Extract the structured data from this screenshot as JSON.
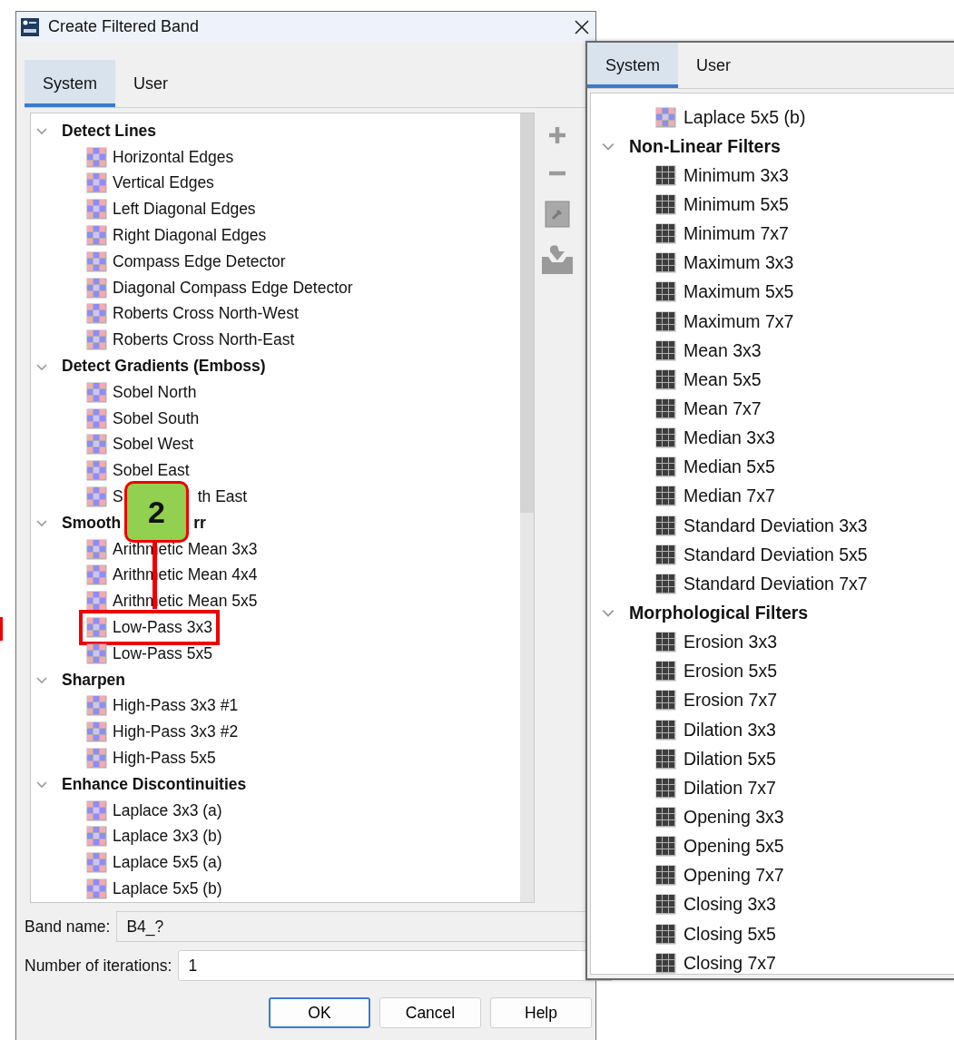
{
  "window": {
    "title": "Create Filtered Band"
  },
  "tabs": [
    {
      "label": "System",
      "selected": true
    },
    {
      "label": "User",
      "selected": false
    }
  ],
  "filter_tree": [
    {
      "label": "Detect Lines",
      "expanded": true,
      "children": [
        {
          "label": "Horizontal Edges",
          "kind": "linear",
          "highlighted": false
        },
        {
          "label": "Vertical Edges",
          "kind": "linear",
          "highlighted": false
        },
        {
          "label": "Left Diagonal Edges",
          "kind": "linear",
          "highlighted": false
        },
        {
          "label": "Right Diagonal Edges",
          "kind": "linear",
          "highlighted": false
        },
        {
          "label": "Compass Edge Detector",
          "kind": "linear",
          "highlighted": false
        },
        {
          "label": "Diagonal Compass Edge Detector",
          "kind": "linear",
          "highlighted": false
        },
        {
          "label": "Roberts Cross North-West",
          "kind": "linear",
          "highlighted": false
        },
        {
          "label": "Roberts Cross North-East",
          "kind": "linear",
          "highlighted": false
        }
      ]
    },
    {
      "label": "Detect Gradients (Emboss)",
      "expanded": true,
      "children": [
        {
          "label": "Sobel North",
          "kind": "linear",
          "highlighted": false
        },
        {
          "label": "Sobel South",
          "kind": "linear",
          "highlighted": false
        },
        {
          "label": "Sobel West",
          "kind": "linear",
          "highlighted": false
        },
        {
          "label": "Sobel East",
          "kind": "linear",
          "highlighted": false
        },
        {
          "fragments": [
            "S",
            "th East"
          ],
          "kind": "linear",
          "highlighted": false
        }
      ]
    },
    {
      "fragments": [
        "Smooth",
        "rr"
      ],
      "expanded": true,
      "children": [
        {
          "label": "Arithmetic Mean 3x3",
          "kind": "linear",
          "highlighted": false
        },
        {
          "label": "Arithmetic Mean 4x4",
          "kind": "linear",
          "highlighted": false
        },
        {
          "label": "Arithmetic Mean 5x5",
          "kind": "linear",
          "highlighted": false
        },
        {
          "label": "Low-Pass 3x3",
          "kind": "linear",
          "highlighted": true
        },
        {
          "label": "Low-Pass 5x5",
          "kind": "linear",
          "highlighted": false
        }
      ]
    },
    {
      "label": "Sharpen",
      "expanded": true,
      "children": [
        {
          "label": "High-Pass 3x3 #1",
          "kind": "linear",
          "highlighted": false
        },
        {
          "label": "High-Pass 3x3 #2",
          "kind": "linear",
          "highlighted": false
        },
        {
          "label": "High-Pass 5x5",
          "kind": "linear",
          "highlighted": false
        }
      ]
    },
    {
      "label": "Enhance Discontinuities",
      "expanded": true,
      "children": [
        {
          "label": "Laplace 3x3 (a)",
          "kind": "linear",
          "highlighted": false
        },
        {
          "label": "Laplace 3x3 (b)",
          "kind": "linear",
          "highlighted": false
        },
        {
          "label": "Laplace 5x5 (a)",
          "kind": "linear",
          "highlighted": false
        },
        {
          "label": "Laplace 5x5 (b)",
          "kind": "linear",
          "highlighted": false
        }
      ]
    }
  ],
  "band_name": {
    "label": "Band name:",
    "value": "B4_?"
  },
  "iterations": {
    "label": "Number of iterations:",
    "value": "1"
  },
  "buttons": [
    {
      "label": "OK",
      "default": true
    },
    {
      "label": "Cancel",
      "default": false
    },
    {
      "label": "Help",
      "default": false
    }
  ],
  "callout": {
    "label": "2"
  },
  "overlay_panel": {
    "tabs": [
      {
        "label": "System",
        "selected": true
      },
      {
        "label": "User",
        "selected": false
      }
    ],
    "filter_tree": [
      {
        "children": [
          {
            "label": "Laplace 5x5 (b)",
            "kind": "linear"
          }
        ]
      },
      {
        "label": "Non-Linear Filters",
        "expanded": true,
        "children": [
          {
            "label": "Minimum 3x3",
            "kind": "nonlinear"
          },
          {
            "label": "Minimum 5x5",
            "kind": "nonlinear"
          },
          {
            "label": "Minimum 7x7",
            "kind": "nonlinear"
          },
          {
            "label": "Maximum 3x3",
            "kind": "nonlinear"
          },
          {
            "label": "Maximum 5x5",
            "kind": "nonlinear"
          },
          {
            "label": "Maximum 7x7",
            "kind": "nonlinear"
          },
          {
            "label": "Mean 3x3",
            "kind": "nonlinear"
          },
          {
            "label": "Mean 5x5",
            "kind": "nonlinear"
          },
          {
            "label": "Mean 7x7",
            "kind": "nonlinear"
          },
          {
            "label": "Median 3x3",
            "kind": "nonlinear"
          },
          {
            "label": "Median 5x5",
            "kind": "nonlinear"
          },
          {
            "label": "Median 7x7",
            "kind": "nonlinear"
          },
          {
            "label": "Standard Deviation 3x3",
            "kind": "nonlinear"
          },
          {
            "label": "Standard Deviation 5x5",
            "kind": "nonlinear"
          },
          {
            "label": "Standard Deviation 7x7",
            "kind": "nonlinear"
          }
        ]
      },
      {
        "label": "Morphological Filters",
        "expanded": true,
        "children": [
          {
            "label": "Erosion 3x3",
            "kind": "nonlinear"
          },
          {
            "label": "Erosion 5x5",
            "kind": "nonlinear"
          },
          {
            "label": "Erosion 7x7",
            "kind": "nonlinear"
          },
          {
            "label": "Dilation 3x3",
            "kind": "nonlinear"
          },
          {
            "label": "Dilation 5x5",
            "kind": "nonlinear"
          },
          {
            "label": "Dilation 7x7",
            "kind": "nonlinear"
          },
          {
            "label": "Opening 3x3",
            "kind": "nonlinear"
          },
          {
            "label": "Opening 5x5",
            "kind": "nonlinear"
          },
          {
            "label": "Opening 7x7",
            "kind": "nonlinear"
          },
          {
            "label": "Closing 3x3",
            "kind": "nonlinear"
          },
          {
            "label": "Closing 5x5",
            "kind": "nonlinear"
          },
          {
            "label": "Closing 7x7",
            "kind": "nonlinear"
          }
        ]
      }
    ]
  }
}
